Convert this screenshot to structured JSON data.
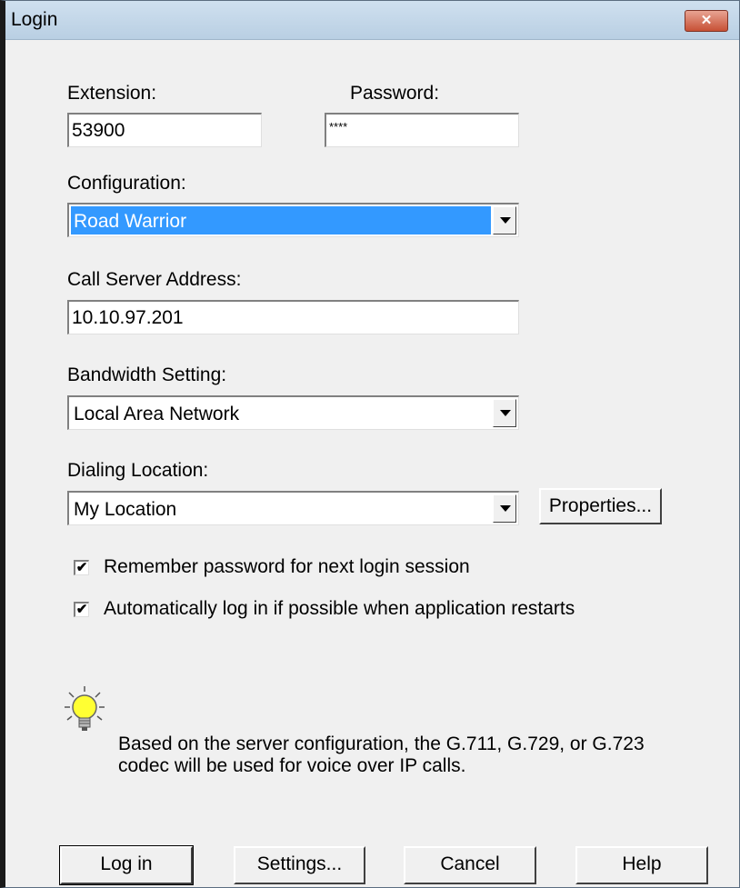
{
  "window": {
    "title": "Login",
    "close_label": "✕"
  },
  "fields": {
    "extension": {
      "label": "Extension:",
      "value": "53900"
    },
    "password": {
      "label": "Password:",
      "value": "****"
    },
    "configuration": {
      "label": "Configuration:",
      "value": "Road Warrior"
    },
    "call_server": {
      "label": "Call Server Address:",
      "value": "10.10.97.201"
    },
    "bandwidth": {
      "label": "Bandwidth Setting:",
      "value": "Local Area Network"
    },
    "dialing": {
      "label": "Dialing Location:",
      "value": "My Location",
      "properties_label": "Properties..."
    }
  },
  "checkboxes": {
    "remember": {
      "label": "Remember password for next login session",
      "mark": "✔"
    },
    "auto_login": {
      "label": "Automatically log in if possible when application restarts",
      "mark": "✔"
    }
  },
  "info": {
    "icon": "lightbulb-icon",
    "text": "Based on the server configuration, the G.711, G.729, or G.723 codec will be used for voice over IP calls."
  },
  "buttons": {
    "login": "Log in",
    "settings": "Settings...",
    "cancel": "Cancel",
    "help": "Help"
  }
}
